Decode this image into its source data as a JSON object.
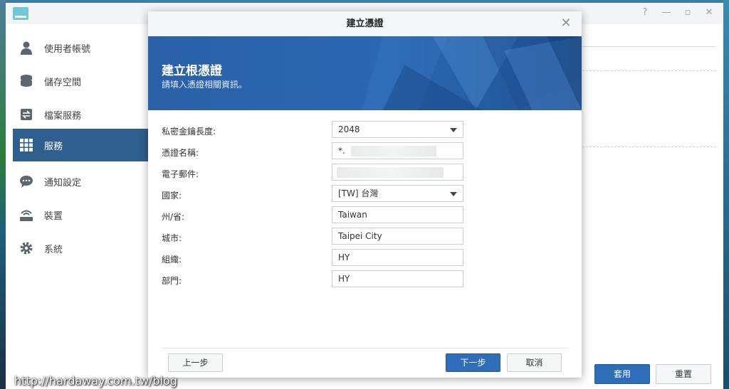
{
  "sidebar": {
    "items": [
      {
        "label": "使用者帳號",
        "icon": "user-icon"
      },
      {
        "label": "儲存空間",
        "icon": "storage-icon"
      },
      {
        "label": "檔案服務",
        "icon": "file-service-icon"
      },
      {
        "label": "服務",
        "icon": "grid-icon",
        "active": true
      },
      {
        "label": "通知設定",
        "icon": "chat-bubble-icon"
      },
      {
        "label": "裝置",
        "icon": "router-icon"
      },
      {
        "label": "系統",
        "icon": "gear-icon"
      }
    ]
  },
  "main": {
    "apply_label": "套用",
    "reset_label": "重置"
  },
  "dialog": {
    "title": "建立憑證",
    "banner_title": "建立根憑證",
    "banner_subtitle": "請填入憑證相關資訊。",
    "fields": [
      {
        "label": "私密金鑰長度:",
        "value": "2048",
        "type": "select"
      },
      {
        "label": "憑證名稱:",
        "value": "*.",
        "type": "text"
      },
      {
        "label": "電子郵件:",
        "value": "",
        "type": "text"
      },
      {
        "label": "國家:",
        "value": "[TW] 台灣",
        "type": "select"
      },
      {
        "label": "州/省:",
        "value": "Taiwan",
        "type": "text"
      },
      {
        "label": "城市:",
        "value": "Taipei City",
        "type": "text"
      },
      {
        "label": "組織:",
        "value": "HY",
        "type": "text"
      },
      {
        "label": "部門:",
        "value": "HY",
        "type": "text"
      }
    ],
    "back_label": "上一步",
    "next_label": "下一步",
    "cancel_label": "取消"
  },
  "watermark": "http://hardaway.com.tw/blog",
  "colors": {
    "accent": "#2f6db8",
    "sidebar_active": "#2f5f8f",
    "banner": "#2b68b2"
  }
}
